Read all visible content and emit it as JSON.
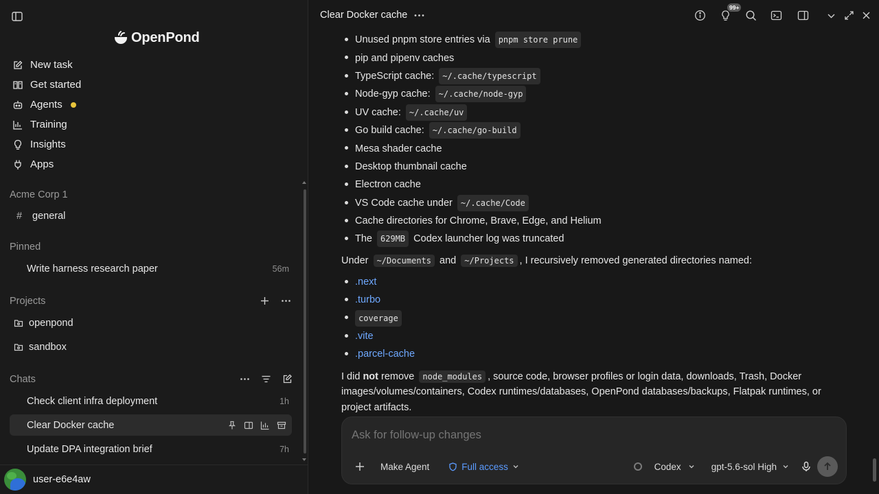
{
  "sidebar": {
    "logo_text": "OpenPond",
    "nav": [
      {
        "label": "New task",
        "icon": "edit-icon"
      },
      {
        "label": "Get started",
        "icon": "book-icon"
      },
      {
        "label": "Agents",
        "icon": "bot-icon"
      },
      {
        "label": "Training",
        "icon": "chart-icon"
      },
      {
        "label": "Insights",
        "icon": "bulb-icon"
      },
      {
        "label": "Apps",
        "icon": "plug-icon"
      }
    ],
    "workspace": {
      "title": "Acme Corp 1",
      "channel_hash": "#",
      "channel": "general"
    },
    "pinned": {
      "title": "Pinned",
      "items": [
        {
          "label": "Write harness research paper",
          "time": "56m"
        }
      ]
    },
    "projects": {
      "title": "Projects",
      "items": [
        {
          "label": "openpond"
        },
        {
          "label": "sandbox"
        }
      ]
    },
    "chats": {
      "title": "Chats",
      "items": [
        {
          "label": "Check client infra deployment",
          "time": "1h"
        },
        {
          "label": "Clear Docker cache",
          "time": ""
        },
        {
          "label": "Update DPA integration brief",
          "time": "7h"
        }
      ]
    },
    "user": {
      "name": "user-e6e4aw"
    }
  },
  "header": {
    "title": "Clear Docker cache",
    "badge": "99+"
  },
  "content": {
    "bullets1": [
      {
        "text": "Unused pnpm store entries via ",
        "code": "pnpm store prune",
        "after": ""
      },
      {
        "text": "pip and pipenv caches",
        "code": "",
        "after": ""
      },
      {
        "text": "TypeScript cache: ",
        "code": "~/.cache/typescript",
        "after": ""
      },
      {
        "text": "Node-gyp cache: ",
        "code": "~/.cache/node-gyp",
        "after": ""
      },
      {
        "text": "UV cache: ",
        "code": "~/.cache/uv",
        "after": ""
      },
      {
        "text": "Go build cache: ",
        "code": "~/.cache/go-build",
        "after": ""
      },
      {
        "text": "Mesa shader cache",
        "code": "",
        "after": ""
      },
      {
        "text": "Desktop thumbnail cache",
        "code": "",
        "after": ""
      },
      {
        "text": "Electron cache",
        "code": "",
        "after": ""
      },
      {
        "text": "VS Code cache under ",
        "code": "~/.cache/Code",
        "after": ""
      },
      {
        "text": "Cache directories for Chrome, Brave, Edge, and Helium",
        "code": "",
        "after": ""
      },
      {
        "text": "The ",
        "code": "629MB",
        "after": " Codex launcher log was truncated"
      }
    ],
    "under_prefix": "Under ",
    "under_code1": "~/Documents",
    "under_and": " and ",
    "under_code2": "~/Projects",
    "under_suffix": ", I recursively removed generated directories named:",
    "bullets2": [
      {
        "text": ".next",
        "type": "link"
      },
      {
        "text": ".turbo",
        "type": "link"
      },
      {
        "text": "coverage",
        "type": "code"
      },
      {
        "text": ".vite",
        "type": "link"
      },
      {
        "text": ".parcel-cache",
        "type": "link"
      }
    ],
    "final_prefix": "I did ",
    "final_bold": "not",
    "final_mid": " remove ",
    "final_code": "node_modules",
    "final_rest": ", source code, browser profiles or login data, downloads, Trash, Docker images/volumes/containers, Codex runtimes/databases, OpenPond databases/backups, Flatpak runtimes, or project artifacts."
  },
  "composer": {
    "placeholder": "Ask for follow-up changes",
    "make_agent": "Make Agent",
    "access": "Full access",
    "provider": "Codex",
    "model": "gpt-5.6-sol High"
  },
  "colors": {
    "accent": "#5b9bff",
    "link": "#6ea8ff",
    "status_dot": "#e9c53b"
  }
}
